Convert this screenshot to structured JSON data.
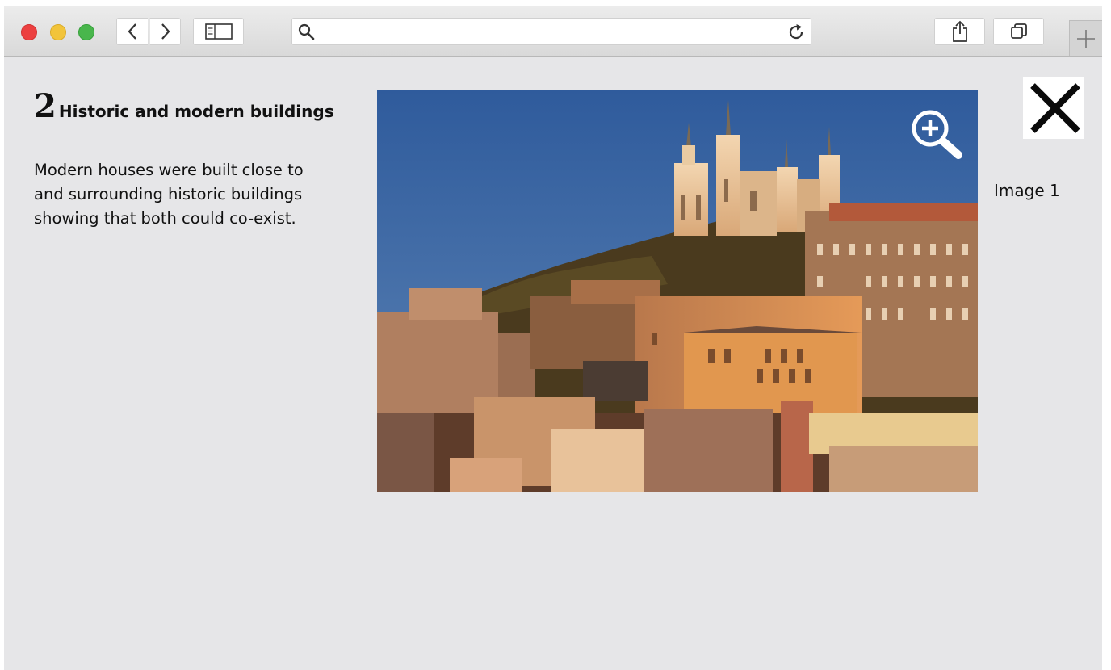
{
  "browser": {
    "address_bar": {
      "value": "",
      "placeholder": ""
    }
  },
  "content": {
    "section_number": "2",
    "section_title": "Historic and modern buildings",
    "description_lines": [
      "Modern houses were built close to",
      "and surrounding historic buildings",
      "showing that both could co-exist."
    ],
    "image_caption": "Image 1"
  },
  "colors": {
    "close_red": "#ec4040",
    "minimize_yellow": "#f2c43a",
    "zoom_green": "#49b64c",
    "page_background": "#e6e6e8"
  },
  "icons": {
    "toolbar": [
      "chevron-left-icon",
      "chevron-right-icon",
      "sidebar-icon",
      "search-icon",
      "reload-icon",
      "share-icon",
      "tabs-icon",
      "plus-icon"
    ],
    "content": [
      "zoom-in-icon",
      "close-icon"
    ]
  }
}
